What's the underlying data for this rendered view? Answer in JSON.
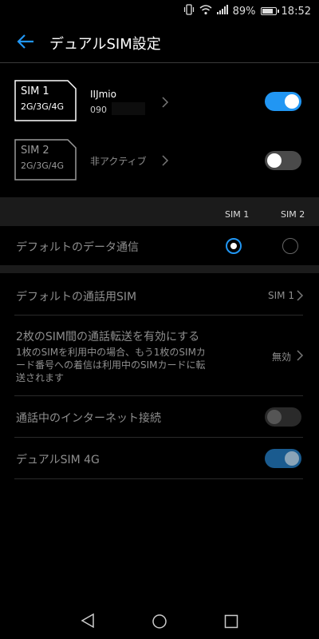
{
  "status_bar": {
    "battery_pct_label": "89%",
    "battery_level": 0.89,
    "time": "18:52",
    "icons": [
      "vibrate-icon",
      "wifi-icon",
      "signal-icon",
      "battery-icon"
    ]
  },
  "app_bar": {
    "title": "デュアルSIM設定"
  },
  "sim1": {
    "name": "SIM 1",
    "gen": "2G/3G/4G",
    "carrier": "IIJmio",
    "number": "090",
    "enabled": true
  },
  "sim2": {
    "name": "SIM 2",
    "gen": "2G/3G/4G",
    "status": "非アクティブ",
    "enabled": false
  },
  "columns": {
    "sim1": "SIM 1",
    "sim2": "SIM 2"
  },
  "default_data": {
    "label": "デフォルトのデータ通信",
    "selected": "sim1"
  },
  "default_call": {
    "label": "デフォルトの通話用SIM",
    "value": "SIM 1"
  },
  "call_forward": {
    "title": "2枚のSIM間の通話転送を有効にする",
    "line1": "1枚のSIMを利用中の場合、もう1枚のSIMカ",
    "line2": "ード番号への着信は利用中のSIMカードに転",
    "line3": "送されます",
    "value": "無効"
  },
  "internet_in_call": {
    "label": "通話中のインターネット接続",
    "enabled": false
  },
  "dual_4g": {
    "label": "デュアルSIM 4G",
    "enabled": true
  },
  "colors": {
    "accent": "#2196f3",
    "toggle_on": "#2196f3",
    "toggle_dim_on": "#1a5b8f",
    "toggle_off": "#4a4a4a",
    "muted_text": "#8e8e8e"
  }
}
